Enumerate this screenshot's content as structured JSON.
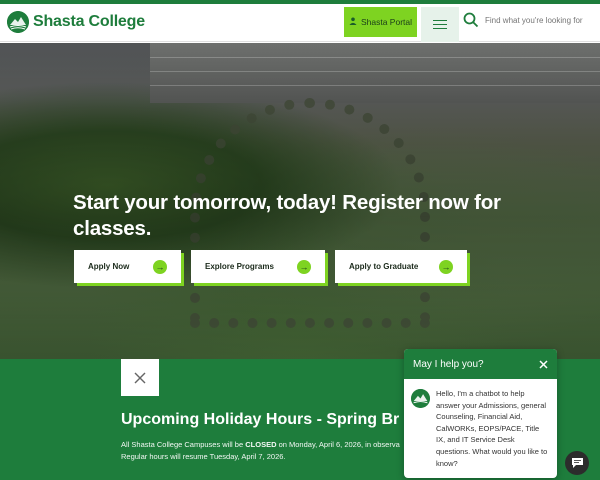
{
  "header": {
    "logo_text": "Shasta College",
    "portal_label": "Shasta Portal",
    "search_placeholder": "Find what you're looking for"
  },
  "hero": {
    "headline": "Start your tomorrow, today! Register now for classes.",
    "buttons": [
      {
        "label": "Apply Now"
      },
      {
        "label": "Explore Programs"
      },
      {
        "label": "Apply to Graduate"
      }
    ]
  },
  "notice": {
    "title": "Upcoming Holiday Hours - Spring Br",
    "body_prefix": "All Shasta College Campuses will be ",
    "body_bold": "CLOSED",
    "body_suffix": " on Monday, April 6, 2026, in observa",
    "body_line2": "Regular hours will resume Tuesday, April 7, 2026."
  },
  "chat": {
    "title": "May I help you?",
    "message": "Hello, I'm a chatbot to help answer your Admissions, general Counseling, Financial Aid, CalWORKs, EOPS/PACE, Title IX, and IT Service Desk questions. What would you like to know?"
  },
  "colors": {
    "brand_green": "#1e7d3c",
    "accent_lime": "#7ed321"
  },
  "icons": {
    "portal": "user-icon",
    "menu": "hamburger-menu-icon",
    "search": "search-icon",
    "cta_arrow": "arrow-right-icon",
    "close": "close-icon",
    "chat_launcher": "chat-bubble-icon"
  }
}
